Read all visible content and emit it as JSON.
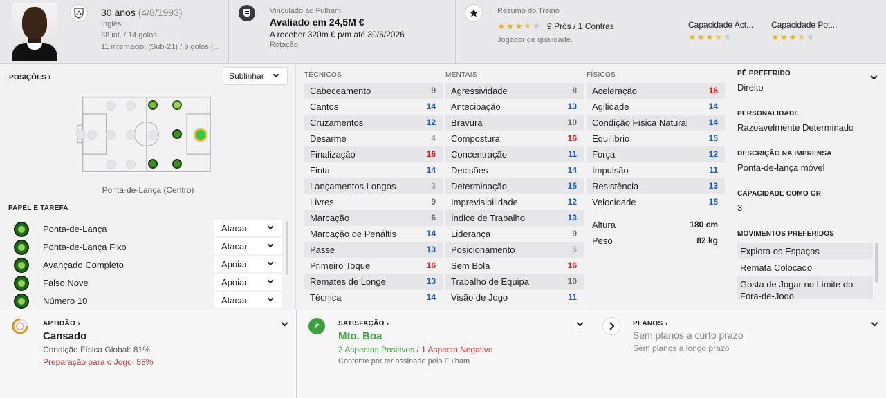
{
  "header": {
    "age": "30 anos",
    "birth": "(4/8/1993)",
    "nationality": "Inglês",
    "caps": "38 int. / 14 golos",
    "u21": "11 internacio. (Sub-21) / 9 golos (...",
    "club_label": "Vinculado ao Fulham",
    "value": "Avaliado em 24,5M €",
    "wage": "A receber 320m € p/m até 30/6/2026",
    "squad_status": "Rotação",
    "training_title": "Resumo do Treino",
    "training_pros_cons": "9 Prós / 1 Contras",
    "training_desc": "Jogador de qualidade.",
    "training_stars": 3.5,
    "current_ability_label": "Capacidade Act...",
    "potential_ability_label": "Capacidade Pot...",
    "current_ability_stars": 3.5,
    "potential_ability_stars": 3.5
  },
  "positions": {
    "title": "POSIÇÕES",
    "dropdown": "Sublinhar",
    "position_name": "Ponta-de-Lança (Centro)"
  },
  "roles": {
    "title": "PAPEL E TAREFA",
    "items": [
      {
        "name": "Ponta-de-Lança",
        "duty": "Atacar"
      },
      {
        "name": "Ponta-de-Lança Fixo",
        "duty": "Atacar"
      },
      {
        "name": "Avançado Completo",
        "duty": "Apoiar"
      },
      {
        "name": "Falso Nove",
        "duty": "Apoiar"
      },
      {
        "name": "Número 10",
        "duty": "Atacar"
      }
    ]
  },
  "attributes": {
    "technical": {
      "title": "TÉCNICOS",
      "items": [
        {
          "name": "Cabeceamento",
          "value": "9"
        },
        {
          "name": "Cantos",
          "value": "14"
        },
        {
          "name": "Cruzamentos",
          "value": "12"
        },
        {
          "name": "Desarme",
          "value": "4"
        },
        {
          "name": "Finalização",
          "value": "16"
        },
        {
          "name": "Finta",
          "value": "14"
        },
        {
          "name": "Lançamentos Longos",
          "value": "3"
        },
        {
          "name": "Livres",
          "value": "9"
        },
        {
          "name": "Marcação",
          "value": "6"
        },
        {
          "name": "Marcação de Penáltis",
          "value": "14"
        },
        {
          "name": "Passe",
          "value": "13"
        },
        {
          "name": "Primeiro Toque",
          "value": "16"
        },
        {
          "name": "Remates de Longe",
          "value": "13"
        },
        {
          "name": "Técnica",
          "value": "14"
        }
      ]
    },
    "mental": {
      "title": "MENTAIS",
      "items": [
        {
          "name": "Agressividade",
          "value": "8"
        },
        {
          "name": "Antecipação",
          "value": "13"
        },
        {
          "name": "Bravura",
          "value": "10"
        },
        {
          "name": "Compostura",
          "value": "16"
        },
        {
          "name": "Concentração",
          "value": "11"
        },
        {
          "name": "Decisões",
          "value": "14"
        },
        {
          "name": "Determinação",
          "value": "15"
        },
        {
          "name": "Imprevisibilidade",
          "value": "12"
        },
        {
          "name": "Índice de Trabalho",
          "value": "13"
        },
        {
          "name": "Liderança",
          "value": "9"
        },
        {
          "name": "Posicionamento",
          "value": "5"
        },
        {
          "name": "Sem Bola",
          "value": "16"
        },
        {
          "name": "Trabalho de Equipa",
          "value": "10"
        },
        {
          "name": "Visão de Jogo",
          "value": "11"
        }
      ]
    },
    "physical": {
      "title": "FÍSICOS",
      "items": [
        {
          "name": "Aceleração",
          "value": "16"
        },
        {
          "name": "Agilidade",
          "value": "14"
        },
        {
          "name": "Condição Física Natural",
          "value": "14"
        },
        {
          "name": "Equilíbrio",
          "value": "15"
        },
        {
          "name": "Força",
          "value": "12"
        },
        {
          "name": "Impulsão",
          "value": "11"
        },
        {
          "name": "Resistência",
          "value": "13"
        },
        {
          "name": "Velocidade",
          "value": "15"
        }
      ],
      "height_label": "Altura",
      "height_value": "180 cm",
      "weight_label": "Peso",
      "weight_value": "82 kg"
    }
  },
  "info": {
    "foot_label": "PÉ PREFERIDO",
    "foot_value": "Direito",
    "personality_label": "PERSONALIDADE",
    "personality_value": "Razoavelmente Determinado",
    "media_label": "DESCRIÇÃO NA IMPRENSA",
    "media_value": "Ponta-de-lança móvel",
    "gk_label": "CAPACIDADE COMO GR",
    "gk_value": "3",
    "moves_label": "MOVIMENTOS PREFERIDOS",
    "moves": [
      "Explora os Espaços",
      "Remata Colocado",
      "Gosta de Jogar no Limite do Fora-de-Jogo"
    ]
  },
  "bottom": {
    "fitness_title": "APTIDÃO",
    "fitness_status": "Cansado",
    "fitness_line1": "Condição Física Global: 81%",
    "fitness_line2": "Preparação para o Jogo: 58%",
    "satisfaction_title": "SATISFAÇÃO",
    "satisfaction_status": "Mto. Boa",
    "satisfaction_positive": "2 Aspectos Positivos",
    "satisfaction_divider": "/",
    "satisfaction_negative": "1 Aspecto Negativo",
    "satisfaction_note": "Contente por ter assinado pelo Fulham",
    "plans_title": "PLANOS",
    "plans_short": "Sem planos a curto prazo",
    "plans_long": "Sem planos a longo prazo"
  },
  "colors": {
    "value_blue": "#1a56cf",
    "value_red": "#d8161c",
    "value_grey": "#6b6b6b",
    "positive_green": "#3aa23a",
    "negative_red": "#c43535",
    "star_gold": "#e3b521"
  }
}
